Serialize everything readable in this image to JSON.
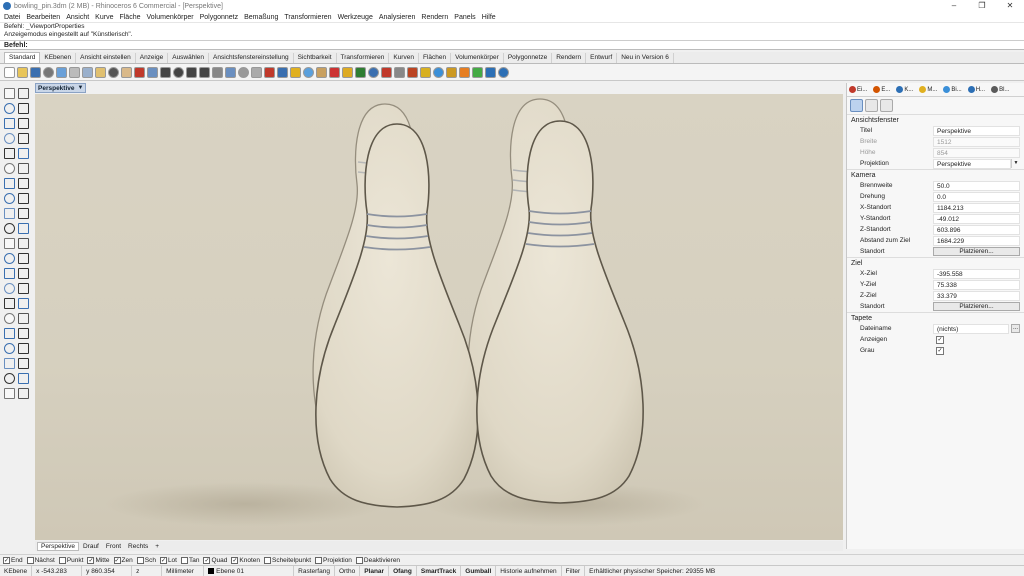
{
  "window": {
    "title": "bowling_pin.3dm (2 MB) - Rhinoceros 6 Commercial - [Perspektive]",
    "controls": [
      "–",
      "❐",
      "✕"
    ]
  },
  "menu": [
    "Datei",
    "Bearbeiten",
    "Ansicht",
    "Kurve",
    "Fläche",
    "Volumenkörper",
    "Polygonnetz",
    "Bemaßung",
    "Transformieren",
    "Werkzeuge",
    "Analysieren",
    "Rendern",
    "Panels",
    "Hilfe"
  ],
  "command": {
    "history": [
      "Befehl: _ViewportProperties",
      "Anzeigemodus eingestellt auf \"Künstlerisch\"."
    ],
    "prompt": "Befehl:"
  },
  "toolbar_tabs": [
    "Standard",
    "KEbenen",
    "Ansicht einstellen",
    "Anzeige",
    "Auswählen",
    "Ansichtsfenstereinstellung",
    "Sichtbarkeit",
    "Transformieren",
    "Kurven",
    "Flächen",
    "Volumenkörper",
    "Polygonnetze",
    "Rendern",
    "Entwurf",
    "Neu in Version 6"
  ],
  "toolbar_icons": [
    "new-file-icon",
    "open-file-icon",
    "save-icon",
    "print-icon",
    "import-icon",
    "cut-icon",
    "copy-icon",
    "paste-icon",
    "undo-icon",
    "pan-hand-icon",
    "move-icon",
    "rotate-view-icon",
    "zoom-icon",
    "zoom-window-icon",
    "zoom-extents-icon",
    "zoom-selected-icon",
    "undo-view-icon",
    "four-viewports-icon",
    "options-icon",
    "grid-icon",
    "points-on-icon",
    "select-all-icon",
    "hide-icon",
    "show-icon",
    "lock-icon",
    "layer-icon",
    "properties-icon",
    "wireframe-icon",
    "shaded-icon",
    "rendered-icon",
    "sphere-icon",
    "material-icon",
    "light-icon",
    "render-icon",
    "scripts-icon",
    "osnap-icon",
    "paint-icon",
    "globe-icon",
    "help-icon"
  ],
  "left_tools": [
    "select-arrow-icon",
    "point-icon",
    "polyline-icon",
    "line-icon",
    "circle-icon",
    "arc-icon",
    "curve-icon",
    "rectangle-icon",
    "polygon-icon",
    "ellipse-icon",
    "fillet-icon",
    "offset-icon",
    "surface-icon",
    "loft-icon",
    "box-icon",
    "sphere-tool-icon",
    "extrude-icon",
    "boolean-icon",
    "mesh-icon",
    "cylinder-icon",
    "edit-icon",
    "trim-icon",
    "split-icon",
    "join-icon",
    "explode-icon",
    "group-icon",
    "transform-icon",
    "mirror-icon",
    "array-icon",
    "scale-icon",
    "text-icon",
    "dimension-icon",
    "analyze-icon",
    "layout-icon",
    "render-tool-icon",
    "light-tool-icon",
    "grid-tool-icon",
    "snap-icon",
    "check-icon",
    "history-icon",
    "clipping-icon",
    "misc-icon"
  ],
  "viewport": {
    "name": "Perspektive",
    "tabs": [
      "Perspektive",
      "Drauf",
      "Front",
      "Rechts",
      "+"
    ]
  },
  "panel": {
    "tabs": [
      {
        "label": "Ei...",
        "color": "#c0392b"
      },
      {
        "label": "E...",
        "color": "#d35400"
      },
      {
        "label": "K...",
        "color": "#2c6fb5"
      },
      {
        "label": "M...",
        "color": "#e0b020"
      },
      {
        "label": "Bi...",
        "color": "#3a8fd8"
      },
      {
        "label": "H...",
        "color": "#2c6fb5"
      },
      {
        "label": "Bl...",
        "color": "#5a5a5a"
      }
    ],
    "sections": {
      "ansichtsfenster": {
        "title": "Ansichtsfenster",
        "rows": [
          {
            "label": "Titel",
            "value": "Perspektive"
          },
          {
            "label": "Breite",
            "value": "1512"
          },
          {
            "label": "Höhe",
            "value": "854"
          },
          {
            "label": "Projektion",
            "value": "Perspektive"
          }
        ]
      },
      "kamera": {
        "title": "Kamera",
        "rows": [
          {
            "label": "Brennweite",
            "value": "50.0"
          },
          {
            "label": "Drehung",
            "value": "0.0"
          },
          {
            "label": "X-Standort",
            "value": "1184.213"
          },
          {
            "label": "Y-Standort",
            "value": "-49.012"
          },
          {
            "label": "Z-Standort",
            "value": "603.896"
          },
          {
            "label": "Abstand zum Ziel",
            "value": "1684.229"
          },
          {
            "label": "Standort",
            "value": "Platzieren..."
          }
        ]
      },
      "ziel": {
        "title": "Ziel",
        "rows": [
          {
            "label": "X-Ziel",
            "value": "-395.558"
          },
          {
            "label": "Y-Ziel",
            "value": "75.338"
          },
          {
            "label": "Z-Ziel",
            "value": "33.379"
          },
          {
            "label": "Standort",
            "value": "Platzieren..."
          }
        ]
      },
      "tapete": {
        "title": "Tapete",
        "rows": [
          {
            "label": "Dateiname",
            "value": "(nichts)",
            "button": "..."
          },
          {
            "label": "Anzeigen",
            "check": "✓"
          },
          {
            "label": "Grau",
            "check": "✓"
          }
        ]
      }
    }
  },
  "osnaps": [
    {
      "label": "End",
      "check": "✓"
    },
    {
      "label": "Nächst",
      "check": ""
    },
    {
      "label": "Punkt",
      "check": ""
    },
    {
      "label": "Mitte",
      "check": "✓"
    },
    {
      "label": "Zen",
      "check": "✓"
    },
    {
      "label": "Sch",
      "check": ""
    },
    {
      "label": "Lot",
      "check": "✓"
    },
    {
      "label": "Tan",
      "check": ""
    },
    {
      "label": "Quad",
      "check": "✓"
    },
    {
      "label": "Knoten",
      "check": "✓"
    },
    {
      "label": "Scheitelpunkt",
      "check": ""
    },
    {
      "label": "Projektion",
      "check": ""
    },
    {
      "label": "Deaktivieren",
      "check": ""
    }
  ],
  "status": {
    "plane": "KEbene",
    "x": "x -543.283",
    "y": "y 860.354",
    "z": "z",
    "units": "Millimeter",
    "layer": "Ebene 01",
    "rasterfang": "Rasterfang",
    "ortho": "Ortho",
    "planar": "Planar",
    "ofang": "Ofang",
    "smarttrack": "SmartTrack",
    "gumball": "Gumball",
    "historie": "Historie aufnehmen",
    "filter": "Filter",
    "memory": "Erhältlicher physischer Speicher: 29355 MB"
  }
}
